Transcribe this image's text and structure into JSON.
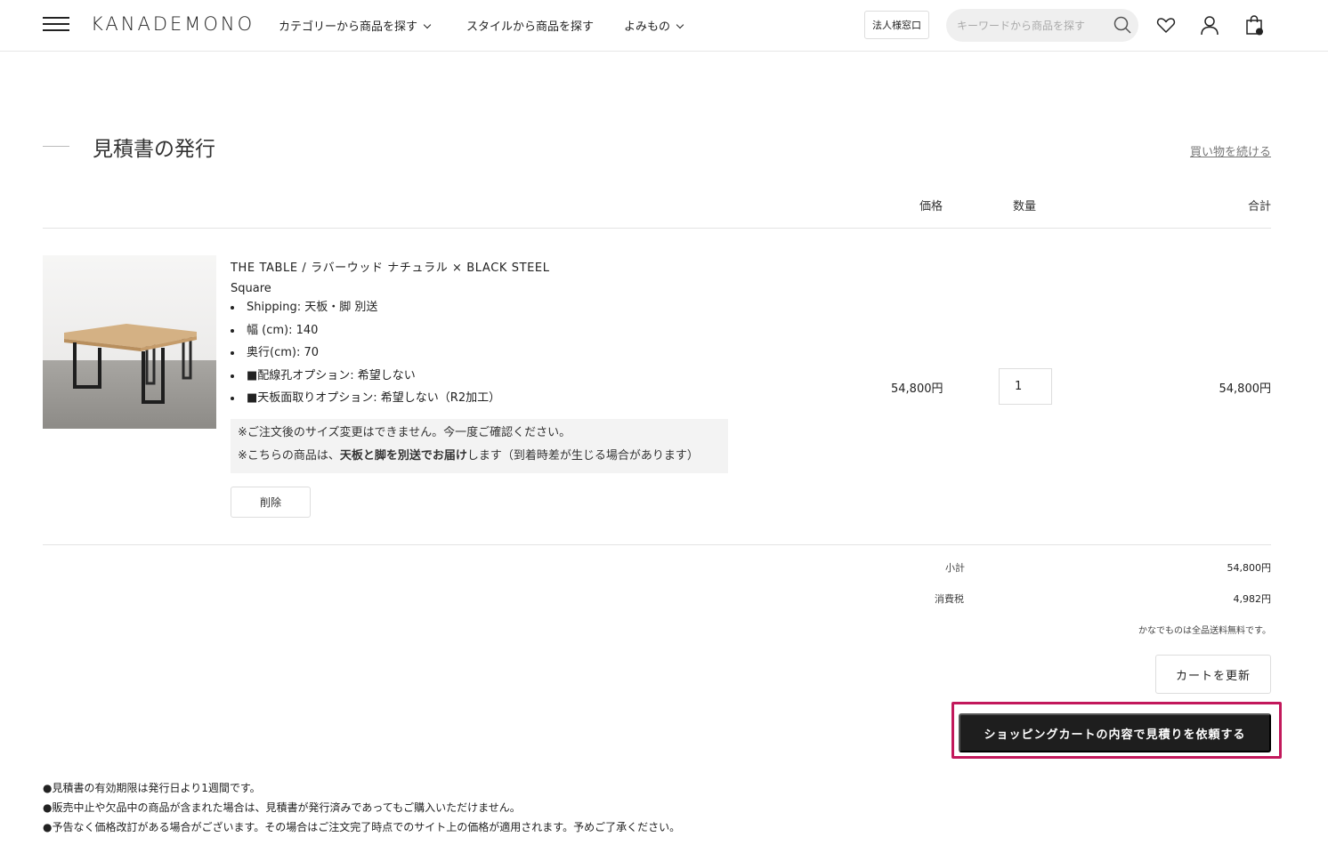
{
  "header": {
    "logo": "KANADEMONO",
    "nav": {
      "category": "カテゴリーから商品を探す",
      "style": "スタイルから商品を探す",
      "reading": "よみもの"
    },
    "business_button": "法人様窓口",
    "search_placeholder": "キーワードから商品を探す"
  },
  "page": {
    "title": "見積書の発行",
    "continue_link": "買い物を続ける"
  },
  "table": {
    "headers": {
      "price": "価格",
      "quantity": "数量",
      "total": "合計"
    }
  },
  "item": {
    "name": "THE TABLE / ラバーウッド ナチュラル × BLACK STEEL",
    "variant": "Square",
    "options": [
      "Shipping: 天板・脚 別送",
      "幅 (cm): 140",
      "奥行(cm): 70",
      "■配線孔オプション: 希望しない",
      "■天板面取りオプション: 希望しない（R2加工）"
    ],
    "notice": {
      "line1": "※ご注文後のサイズ変更はできません。今一度ご確認ください。",
      "line2_pre": "※こちらの商品は、",
      "line2_bold": "天板と脚を別送でお届け",
      "line2_post": "します（到着時差が生じる場合があります）"
    },
    "delete_label": "削除",
    "price": "54,800円",
    "quantity": "1",
    "total": "54,800円"
  },
  "summary": {
    "subtotal_label": "小計",
    "subtotal_value": "54,800円",
    "tax_label": "消費税",
    "tax_value": "4,982円",
    "shipping_note": "かなでものは全品送料無料です。",
    "update_label": "カートを更新",
    "request_label": "ショッピングカートの内容で見積りを依頼する"
  },
  "footnotes": [
    "●見積書の有効期限は発行日より1週間です。",
    "●販売中止や欠品中の商品が含まれた場合は、見積書が発行済みであってもご購入いただけません。",
    "●予告なく価格改訂がある場合がございます。その場合はご注文完了時点でのサイト上の価格が適用されます。予めご了承ください。"
  ],
  "colors": {
    "highlight": "#c2185b",
    "primary_button": "#1e1e1e"
  }
}
